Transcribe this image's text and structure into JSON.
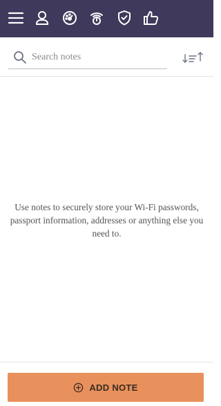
{
  "toolbar": {
    "icons": [
      "menu-icon",
      "user-icon",
      "dashboard-icon",
      "antivirus-icon",
      "shield-icon",
      "thumbs-up-icon"
    ],
    "background": "#3f3a5b",
    "icon_color": "#ffffff"
  },
  "search": {
    "placeholder": "Search notes",
    "value": ""
  },
  "empty_state": {
    "message": "Use notes to securely store your Wi-Fi passwords, passport information, addresses or anything else you need to."
  },
  "actions": {
    "add_note_label": "ADD NOTE",
    "accent": "#e8915c"
  }
}
